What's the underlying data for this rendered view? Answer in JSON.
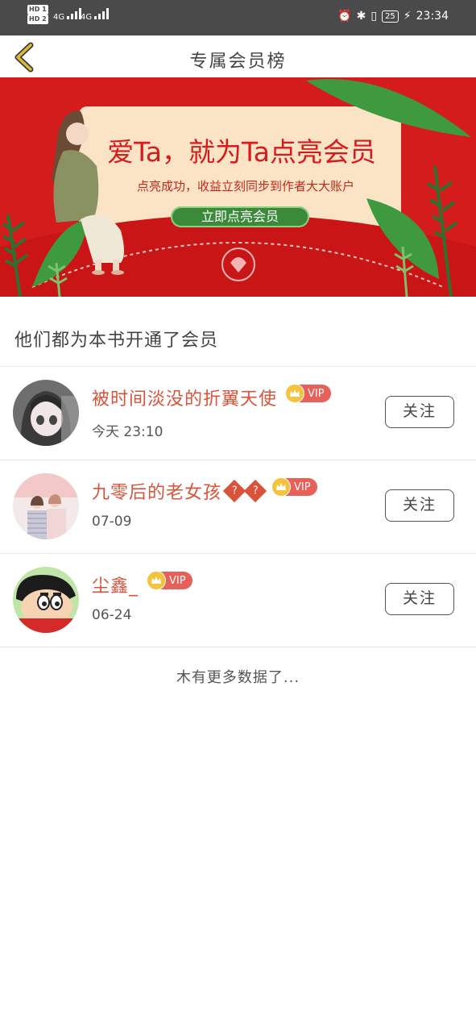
{
  "status_bar": {
    "hd1": "HD 1",
    "hd2": "HD 2",
    "net1": "4G",
    "net2": "4G",
    "battery": "25",
    "time": "23:34"
  },
  "header": {
    "title": "专属会员榜",
    "back_icon": "chevron-left-icon"
  },
  "banner": {
    "headline": "爱Ta，就为Ta点亮会员",
    "subline": "点亮成功，收益立刻同步到作者大大账户",
    "cta": "立即点亮会员",
    "colors": {
      "background": "#d41c1c",
      "card": "#fbe3c6",
      "cta": "#3a8a3a"
    }
  },
  "section_title": "他们都为本书开通了会员",
  "members": [
    {
      "name": "被时间淡没的折翼天使",
      "badge": "VIP",
      "time": "今天 23:10",
      "follow": "关注"
    },
    {
      "name": "九零后的老女孩",
      "name_suffix": "?",
      "badge": "VIP",
      "time": "07-09",
      "follow": "关注"
    },
    {
      "name": "尘鑫_",
      "badge": "VIP",
      "time": "06-24",
      "follow": "关注"
    }
  ],
  "footer_note": "木有更多数据了...",
  "accent_colors": {
    "name": "#d9533a",
    "vip": "#e8605a",
    "crown": "#f5c33b"
  }
}
